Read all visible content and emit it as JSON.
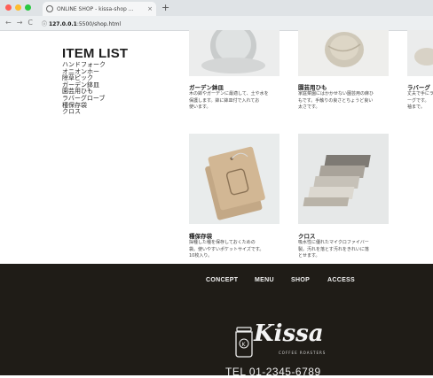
{
  "browser": {
    "tab_title": "ONLINE SHOP - kissa-shop ...",
    "tab_close": "×",
    "new_tab": "+",
    "back": "←",
    "forward": "→",
    "reload": "C",
    "url_scheme": "ⓘ",
    "url_host": "127.0.0.1",
    "url_path": ":5500/shop.html"
  },
  "sidebar": {
    "heading": "ITEM LIST",
    "items": [
      "ハンドフォーク",
      "オニオンホー",
      "除草ピック",
      "ガーデン鉢皿",
      "園芸用ひも",
      "ラバーグローブ",
      "種保存袋",
      "クロス"
    ]
  },
  "products": [
    {
      "title": "ガーデン鉢皿",
      "desc": "木の鉢やガーデンに最適して、土や水を\n保護します。鉢に鉢皿付で入れてお\n使います。"
    },
    {
      "title": "園芸用ひも",
      "desc": "家庭菜園にはかかせない園芸用の麻ひ\nもです。手触りの良さとちょうど良い\n太さです。"
    },
    {
      "title": "ラバーグ",
      "desc": "丈夫で手にラバ\nーグです。\n袖まで。"
    },
    {
      "title": "種保存袋",
      "desc": "採種した種を保存しておくための\n袋。使いやすいポケットサイズです。\n10枚入り。"
    },
    {
      "title": "クロス",
      "desc": "吸水性に優れたマイクロファイバー\n製。汚れを落とす汚れをきれいに落\nとせます。"
    }
  ],
  "footer": {
    "nav": [
      "CONCEPT",
      "MENU",
      "SHOP",
      "ACCESS"
    ],
    "logo_text": "Kissa",
    "logo_sub": "COFFEE ROASTERS",
    "tel": "TEL 01-2345-6789"
  },
  "colors": {
    "footer_bg": "#1f1c17",
    "dot_red": "#ff5f57",
    "dot_yellow": "#febc2e",
    "dot_green": "#28c840"
  }
}
